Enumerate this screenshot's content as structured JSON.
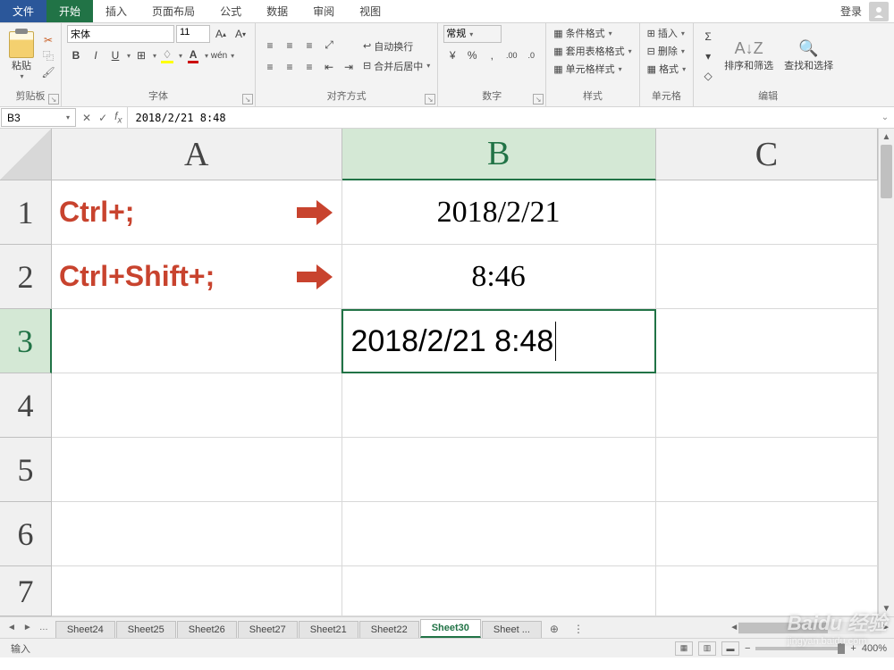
{
  "titlebar": {
    "file": "文件",
    "active": "开始",
    "tabs": [
      "插入",
      "页面布局",
      "公式",
      "数据",
      "审阅",
      "视图"
    ],
    "login": "登录"
  },
  "ribbon": {
    "clipboard": {
      "paste": "粘贴",
      "label": "剪贴板"
    },
    "font": {
      "name": "宋体",
      "size": "11",
      "label": "字体"
    },
    "align": {
      "wrap": "自动换行",
      "merge": "合并后居中",
      "label": "对齐方式"
    },
    "number": {
      "format": "常规",
      "label": "数字"
    },
    "styles": {
      "cond": "条件格式",
      "table_fmt": "套用表格格式",
      "cell_style": "单元格样式",
      "label": "样式"
    },
    "cells": {
      "insert": "插入",
      "delete": "删除",
      "format": "格式",
      "label": "单元格"
    },
    "editing": {
      "sort": "排序和筛选",
      "find": "查找和选择",
      "label": "编辑"
    }
  },
  "formula_bar": {
    "name_box": "B3",
    "value": "2018/2/21 8:48"
  },
  "grid": {
    "cols": [
      "A",
      "B",
      "C"
    ],
    "rows": [
      "1",
      "2",
      "3",
      "4",
      "5",
      "6",
      "7"
    ],
    "a1": "Ctrl+;",
    "b1": "2018/2/21",
    "a2": "Ctrl+Shift+;",
    "b2": "8:46",
    "b3": "2018/2/21 8:48"
  },
  "sheets": {
    "tabs": [
      "Sheet24",
      "Sheet25",
      "Sheet26",
      "Sheet27",
      "Sheet21",
      "Sheet22",
      "Sheet30",
      "Sheet ..."
    ],
    "active_index": 6
  },
  "status": {
    "mode": "输入",
    "zoom": "400%"
  },
  "watermark": {
    "brand": "Baidu",
    "sub": "经验",
    "url": "jingyan.baidu.com"
  }
}
